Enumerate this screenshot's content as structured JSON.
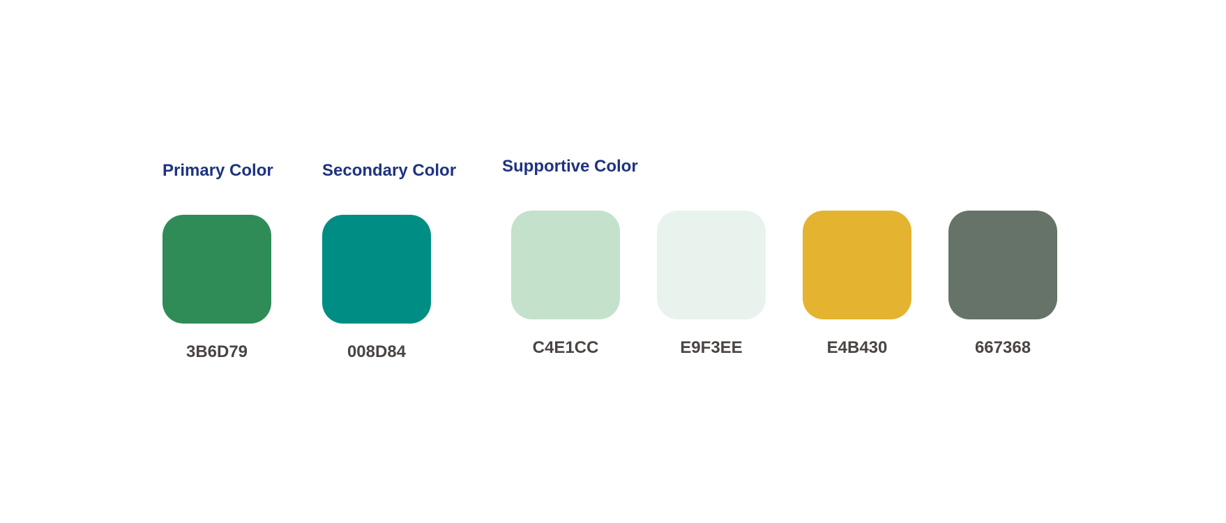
{
  "title_color": "#1E3380",
  "label_color": "#4A4542",
  "groups": {
    "primary": {
      "title": "Primary Color",
      "swatches": [
        {
          "label": "3B6D79",
          "fill": "#2F8C57"
        }
      ]
    },
    "secondary": {
      "title": "Secondary Color",
      "swatches": [
        {
          "label": "008D84",
          "fill": "#008D84"
        }
      ]
    },
    "supportive": {
      "title": "Supportive Color",
      "swatches": [
        {
          "label": "C4E1CC",
          "fill": "#C4E1CC"
        },
        {
          "label": "E9F3EE",
          "fill": "#E9F3EE"
        },
        {
          "label": "E4B430",
          "fill": "#E4B430"
        },
        {
          "label": "667368",
          "fill": "#667368"
        }
      ]
    }
  }
}
